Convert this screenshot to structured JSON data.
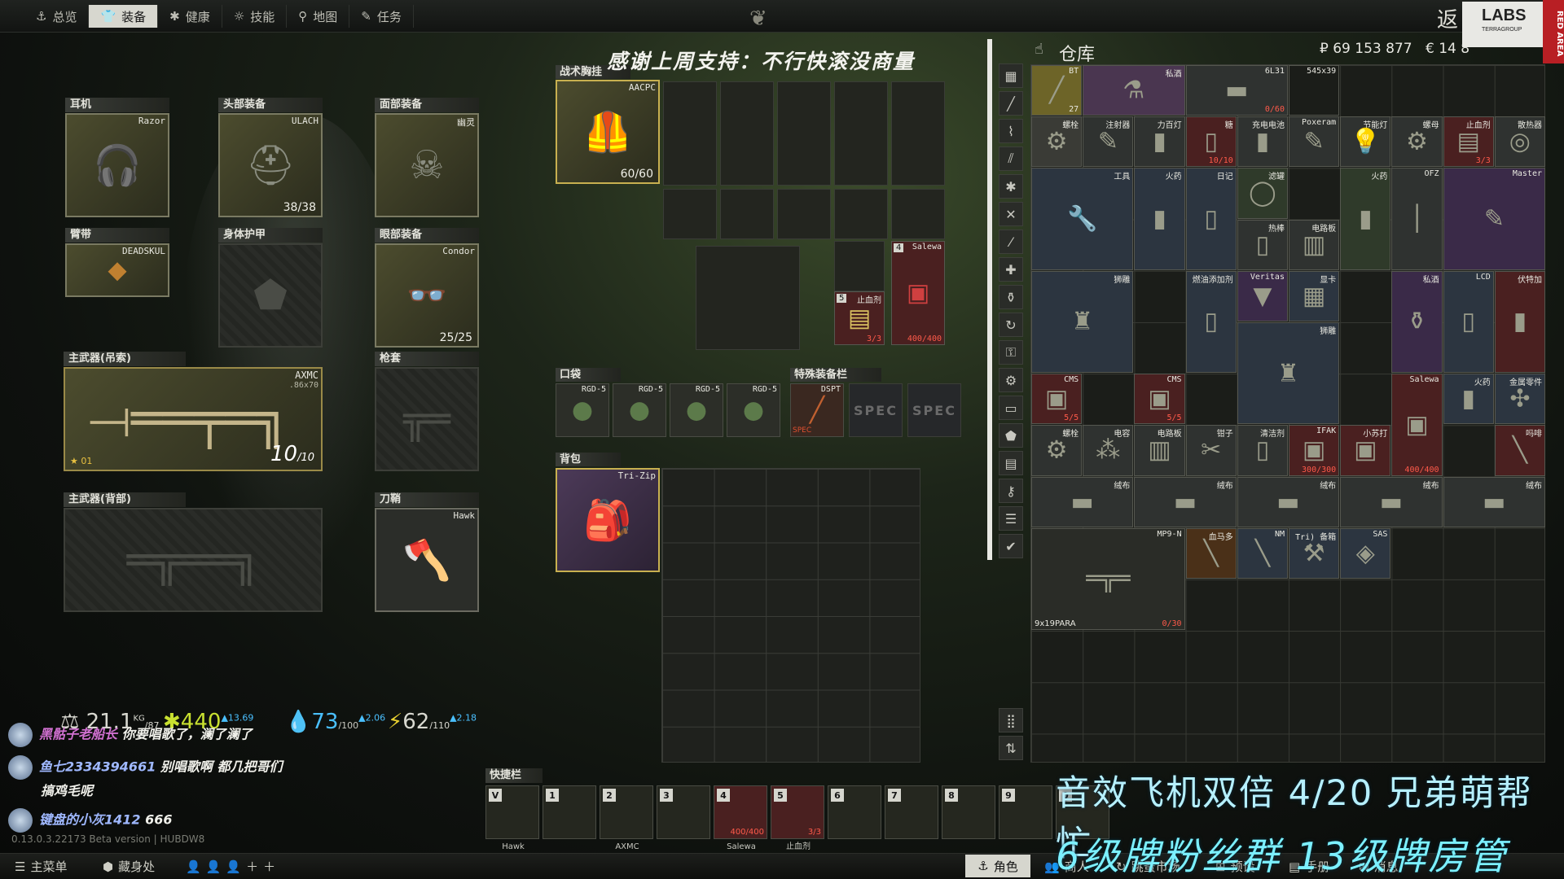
{
  "nav": {
    "tabs": [
      {
        "label": "总览",
        "icon": "overview-icon",
        "active": false
      },
      {
        "label": "装备",
        "icon": "gear-icon",
        "active": true
      },
      {
        "label": "健康",
        "icon": "health-icon",
        "active": false
      },
      {
        "label": "技能",
        "icon": "skills-icon",
        "active": false
      },
      {
        "label": "地图",
        "icon": "map-pin-icon",
        "active": false
      },
      {
        "label": "任务",
        "icon": "tasks-icon",
        "active": false
      }
    ],
    "back_label": "返",
    "logo_text": "LABS",
    "logo_sub": "TERRAGROUP",
    "red_area": "RED AREA"
  },
  "equipment": {
    "earpiece": {
      "label": "耳机",
      "item": "Razor"
    },
    "headwear": {
      "label": "头部装备",
      "item": "ULACH",
      "durability": "38/38"
    },
    "face_cover": {
      "label": "面部装备",
      "item": "幽灵"
    },
    "armband": {
      "label": "臂带",
      "item": "DEADSKUL"
    },
    "body_armor": {
      "label": "身体护甲"
    },
    "eyewear": {
      "label": "眼部装备",
      "item": "Condor",
      "durability": "25/25"
    },
    "primary_sling": {
      "label": "主武器(吊索)",
      "item": "AXMC",
      "caliber": ".86x70",
      "ammo": "10",
      "ammo_max": "/10",
      "level": "01"
    },
    "holster": {
      "label": "枪套"
    },
    "primary_back": {
      "label": "主武器(背部)"
    },
    "scabbard": {
      "label": "刀鞘",
      "item": "Hawk"
    }
  },
  "rig": {
    "label": "战术胸挂",
    "item": "AACPC",
    "durability": "60/60",
    "banner": "感谢上周支持：不行快滚没商量",
    "small_items": [
      {
        "num": "5",
        "name": "止血剂",
        "count": "3/3"
      },
      {
        "num": "4",
        "name": "Salewa",
        "count": "400/400"
      }
    ]
  },
  "pockets": {
    "label": "口袋",
    "items": [
      "RGD-5",
      "RGD-5",
      "RGD-5",
      "RGD-5"
    ]
  },
  "special": {
    "label": "特殊装备栏",
    "items": [
      "DSPT",
      "SPEC",
      "SPEC"
    ],
    "sub": "SPEC"
  },
  "backpack": {
    "label": "背包",
    "item": "Tri-Zip"
  },
  "stash": {
    "title": "仓库",
    "rubles": "₽ 69 153 877",
    "euros": "€ 14 8",
    "items": [
      {
        "name": "BT",
        "count": "27",
        "color": "#6d6428"
      },
      {
        "name": "私酒",
        "count": "",
        "color": "#4a3650"
      },
      {
        "name": "6L31",
        "count": "0/60",
        "color": "#2f3230"
      },
      {
        "name": "545x39",
        "count": "",
        "color": "#1b1d19"
      },
      {
        "name": "螺栓",
        "count": "",
        "color": "#3a3b36"
      },
      {
        "name": "注射器",
        "count": "",
        "color": "#2f3230"
      },
      {
        "name": "力百灯",
        "count": "",
        "color": "#2f3230"
      },
      {
        "name": "糖",
        "count": "10/10",
        "color": "#4a2020"
      },
      {
        "name": "充电电池",
        "count": "",
        "color": "#2f3230"
      },
      {
        "name": "Poxeram",
        "count": "",
        "color": "#2f3230"
      },
      {
        "name": "节能灯",
        "count": "",
        "color": "#2f3230"
      },
      {
        "name": "螺母",
        "count": "",
        "color": "#2f3230"
      },
      {
        "name": "止血剂",
        "count": "3/3",
        "color": "#4a2020"
      },
      {
        "name": "散热器",
        "count": "",
        "color": "#2f3230"
      },
      {
        "name": "工具",
        "count": "",
        "color": "#2c3540"
      },
      {
        "name": "火药",
        "count": "",
        "color": "#2c3540"
      },
      {
        "name": "日记",
        "count": "",
        "color": "#2c3540"
      },
      {
        "name": "滤罐",
        "count": "",
        "color": "#2f3a2a"
      },
      {
        "name": "火药",
        "count": "",
        "color": "#2f3a2a"
      },
      {
        "name": "OFZ",
        "count": "",
        "color": "#2f3230"
      },
      {
        "name": "Master",
        "count": "",
        "color": "#3a2a48"
      },
      {
        "name": "热棒",
        "count": "",
        "color": "#2f3230"
      },
      {
        "name": "电路板",
        "count": "",
        "color": "#2f3230"
      },
      {
        "name": "狮雕",
        "count": "",
        "color": "#2c3540"
      },
      {
        "name": "燃油添加剂",
        "count": "",
        "color": "#2c3540"
      },
      {
        "name": "Veritas",
        "count": "",
        "color": "#3a2a48"
      },
      {
        "name": "显卡",
        "count": "",
        "color": "#2c3540"
      },
      {
        "name": "私酒",
        "count": "",
        "color": "#3a2a48"
      },
      {
        "name": "LCD",
        "count": "",
        "color": "#2c3540"
      },
      {
        "name": "伏特加",
        "count": "",
        "color": "#4a2020"
      },
      {
        "name": "狮雕",
        "count": "",
        "color": "#2c3540"
      },
      {
        "name": "CMS",
        "count": "5/5",
        "color": "#4a2020"
      },
      {
        "name": "CMS",
        "count": "5/5",
        "color": "#4a2020"
      },
      {
        "name": "Salewa",
        "count": "400/400",
        "color": "#4a2020"
      },
      {
        "name": "火药",
        "count": "",
        "color": "#2c3540"
      },
      {
        "name": "金属零件",
        "count": "",
        "color": "#2c3540"
      },
      {
        "name": "螺栓",
        "count": "",
        "color": "#2f3230"
      },
      {
        "name": "电容",
        "count": "",
        "color": "#2f3230"
      },
      {
        "name": "电路板",
        "count": "",
        "color": "#2f3230"
      },
      {
        "name": "钳子",
        "count": "",
        "color": "#2f3230"
      },
      {
        "name": "清洁剂",
        "count": "",
        "color": "#2f3230"
      },
      {
        "name": "IFAK",
        "count": "300/300",
        "color": "#4a2020"
      },
      {
        "name": "小苏打",
        "count": "",
        "color": "#4a2020"
      },
      {
        "name": "吗啡",
        "count": "",
        "color": "#4a2020"
      },
      {
        "name": "绒布",
        "count": "",
        "color": "#2f3230"
      },
      {
        "name": "绒布",
        "count": "",
        "color": "#2f3230"
      },
      {
        "name": "绒布",
        "count": "",
        "color": "#2f3230"
      },
      {
        "name": "绒布",
        "count": "",
        "color": "#2f3230"
      },
      {
        "name": "绒布",
        "count": "",
        "color": "#2f3230"
      },
      {
        "name": "MP9-N",
        "count": "0/30",
        "sub": "9x19PARA",
        "color": "#2a2c27"
      },
      {
        "name": "血马多",
        "count": "",
        "color": "#4a3018"
      },
      {
        "name": "NM",
        "count": "",
        "color": "#2c3540"
      },
      {
        "name": "Tri) 备箱",
        "count": "",
        "color": "#2c3540"
      },
      {
        "name": "SAS",
        "count": "",
        "color": "#2c3540"
      }
    ]
  },
  "status": {
    "weight": "21.1",
    "weight_unit": "KG",
    "weight_max": "/87",
    "energy": "440",
    "energy_delta": "▲13.69",
    "hydration": "73",
    "hydration_max": "/100",
    "hydration_delta": "▲2.06",
    "power": "62",
    "power_max": "/110",
    "power_delta": "▲2.18"
  },
  "chat": [
    {
      "user": "黑骷子老船长",
      "message": "你要唱歌了，澜了澜了"
    },
    {
      "user": "鱼七2334394661",
      "message": "别唱歌啊 都几把哥们"
    },
    {
      "user": "",
      "message": "搞鸡毛呢"
    },
    {
      "user": "键盘的小灰1412",
      "message": "666"
    }
  ],
  "version": "0.13.0.3.22173 Beta version | HUBDW8",
  "quickbar": {
    "label": "快捷栏",
    "slots": [
      {
        "key": "V",
        "sub": "Hawk"
      },
      {
        "key": "1",
        "sub": ""
      },
      {
        "key": "2",
        "sub": "AXMC"
      },
      {
        "key": "3",
        "sub": ""
      },
      {
        "key": "4",
        "sub": "Salewa",
        "count": "400/400"
      },
      {
        "key": "5",
        "sub": "止血剂",
        "count": "3/3"
      },
      {
        "key": "6",
        "sub": ""
      },
      {
        "key": "7",
        "sub": ""
      },
      {
        "key": "8",
        "sub": ""
      },
      {
        "key": "9",
        "sub": ""
      },
      {
        "key": "0",
        "sub": ""
      }
    ]
  },
  "bottom_bar": {
    "main_menu": "主菜单",
    "hideout": "藏身处",
    "character": "角色",
    "traders": "商人",
    "flea_market": "跳蚤市场",
    "presets": "预设",
    "handbook": "手册",
    "messages": "消息"
  },
  "overlay": {
    "line1": "音效飞机双倍  4/20  兄弟萌帮忙",
    "line2": "6级牌粉丝群  13级牌房管"
  }
}
